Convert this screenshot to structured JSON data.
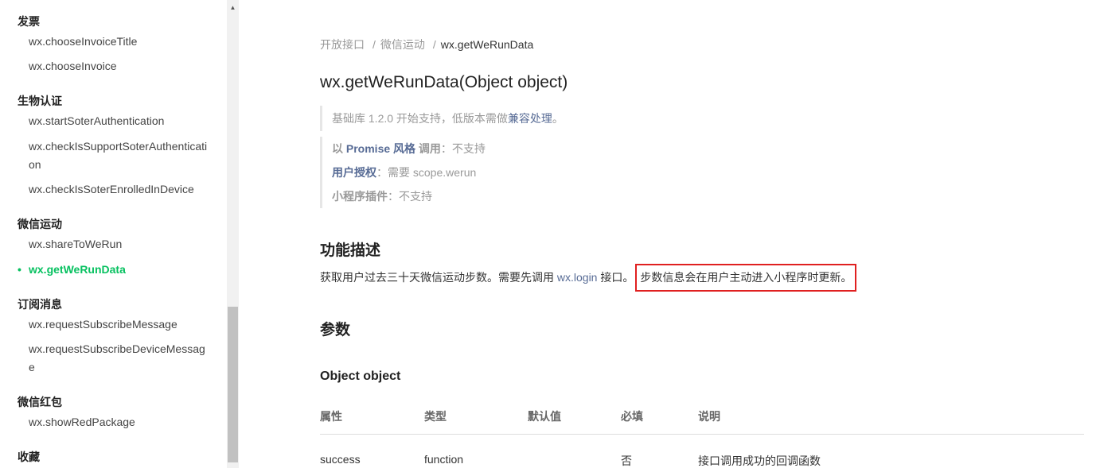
{
  "sidebar": {
    "groups": [
      {
        "title": "发票",
        "items": [
          "wx.chooseInvoiceTitle",
          "wx.chooseInvoice"
        ]
      },
      {
        "title": "生物认证",
        "items": [
          "wx.startSoterAuthentication",
          "wx.checkIsSupportSoterAuthentication",
          "wx.checkIsSoterEnrolledInDevice"
        ]
      },
      {
        "title": "微信运动",
        "items": [
          "wx.shareToWeRun",
          "wx.getWeRunData"
        ]
      },
      {
        "title": "订阅消息",
        "items": [
          "wx.requestSubscribeMessage",
          "wx.requestSubscribeDeviceMessage"
        ]
      },
      {
        "title": "微信红包",
        "items": [
          "wx.showRedPackage"
        ]
      },
      {
        "title": "收藏",
        "items": []
      }
    ],
    "active_item": "wx.getWeRunData"
  },
  "breadcrumb": {
    "items": [
      "开放接口",
      "微信运动",
      "wx.getWeRunData"
    ],
    "separator": "/"
  },
  "page_title": "wx.getWeRunData(Object object)",
  "support_note": {
    "prefix": "基础库 1.2.0 开始支持，低版本需做",
    "link": "兼容处理",
    "suffix": "。"
  },
  "meta_notes": {
    "promise_label_prefix": "以 ",
    "promise_label_strong": "Promise 风格",
    "promise_label_suffix": " 调用",
    "promise_value": "：不支持",
    "auth_label": "用户授权",
    "auth_value": "：需要 scope.werun",
    "plugin_label": "小程序插件",
    "plugin_value": "：不支持"
  },
  "section_desc": {
    "title": "功能描述",
    "text_before": "获取用户过去三十天微信运动步数。需要先调用 ",
    "link": "wx.login",
    "text_after": " 接口。",
    "highlight": "步数信息会在用户主动进入小程序时更新。"
  },
  "section_params": {
    "title": "参数",
    "object_title": "Object object",
    "headers": [
      "属性",
      "类型",
      "默认值",
      "必填",
      "说明"
    ],
    "rows": [
      [
        "success",
        "function",
        "",
        "否",
        "接口调用成功的回调函数"
      ]
    ]
  },
  "colors": {
    "accent_green": "#07c160",
    "link_blue": "#576b95",
    "highlight_red": "#e02020"
  }
}
